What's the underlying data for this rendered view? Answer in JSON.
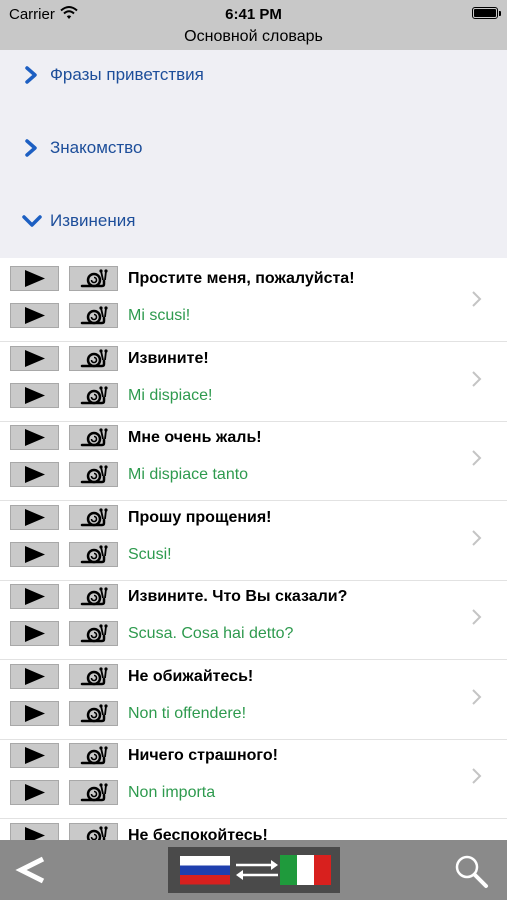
{
  "status_bar": {
    "carrier": "Carrier",
    "time": "6:41 PM"
  },
  "nav": {
    "title": "Основной словарь"
  },
  "categories": [
    {
      "label": "Фразы приветствия",
      "expanded": false
    },
    {
      "label": "Знакомство",
      "expanded": false
    },
    {
      "label": "Извинения",
      "expanded": true
    }
  ],
  "phrases": [
    {
      "ru": "Простите меня, пожалуйста!",
      "it": "Mi scusi!"
    },
    {
      "ru": "Извините!",
      "it": "Mi dispiace!"
    },
    {
      "ru": "Мне очень жаль!",
      "it": "Mi dispiace tanto"
    },
    {
      "ru": "Прошу прощения!",
      "it": "Scusi!"
    },
    {
      "ru": "Извините. Что Вы сказали?",
      "it": "Scusa. Cosa hai detto?"
    },
    {
      "ru": "Не обижайтесь!",
      "it": "Non ti offendere!"
    },
    {
      "ru": "Ничего страшного!",
      "it": "Non importa"
    },
    {
      "ru": "Не беспокойтесь!",
      "it": ""
    }
  ],
  "toolbar": {
    "back_icon": "chevron-left-icon",
    "search_icon": "magnifier-icon",
    "switch": "russian-italian-flag-switch"
  },
  "colors": {
    "header_bg": "#c8c8c8",
    "category_text": "#1d4e9a",
    "italian_text": "#2e9a4e",
    "toolbar_bg": "#8a8a8a"
  }
}
